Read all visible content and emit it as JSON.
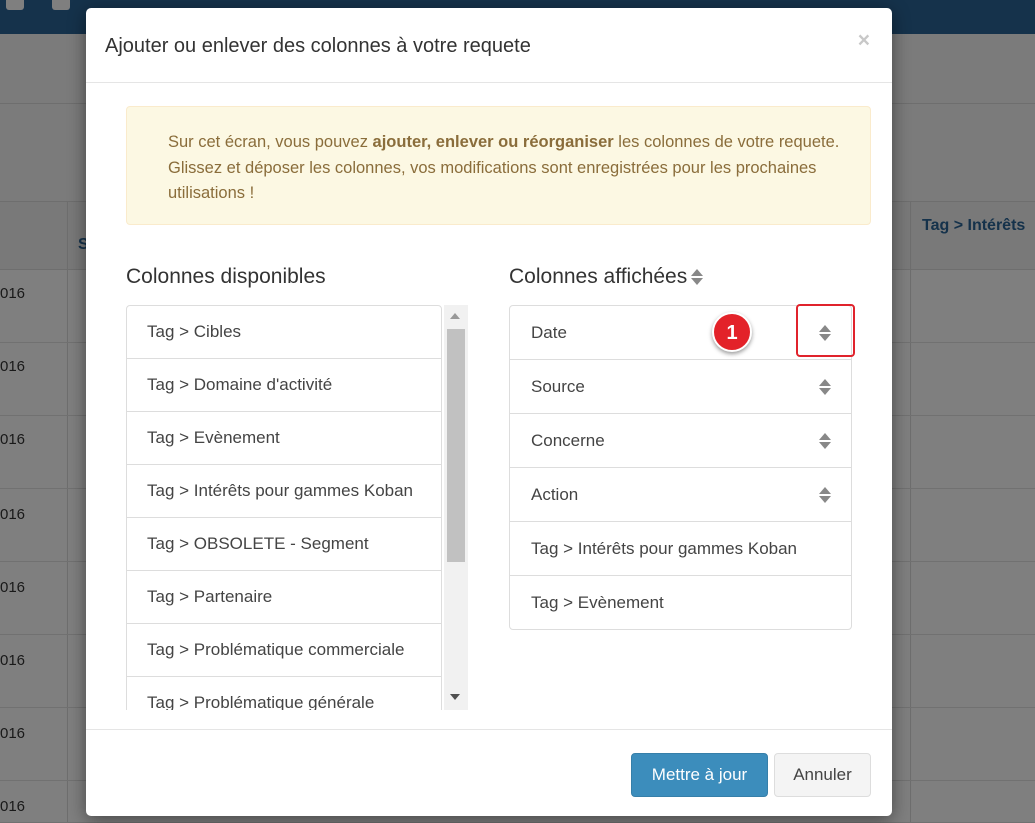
{
  "background": {
    "column_header_s": "S",
    "column_header_tag": "Tag > Intérêts",
    "row_cells": [
      "016",
      "016",
      "016",
      "016",
      "016",
      "016",
      "016",
      "016"
    ]
  },
  "modal": {
    "title": "Ajouter ou enlever des colonnes à votre requete",
    "close_label": "×",
    "alert": {
      "text_before": "Sur cet écran, vous pouvez ",
      "text_bold": "ajouter, enlever ou réorganiser",
      "text_after": " les colonnes de votre requete. Glissez et déposer les colonnes, vos modifications sont enregistrées pour les prochaines utilisations !"
    },
    "available": {
      "title": "Colonnes disponibles",
      "items": [
        "Tag > Cibles",
        "Tag > Domaine d'activité",
        "Tag > Evènement",
        "Tag > Intérêts pour gammes Koban",
        "Tag > OBSOLETE - Segment",
        "Tag > Partenaire",
        "Tag > Problématique commerciale",
        "Tag > Problématique générale"
      ]
    },
    "displayed": {
      "title": "Colonnes affichées",
      "items": [
        "Date",
        "Source",
        "Concerne",
        "Action",
        "Tag > Intérêts pour gammes Koban",
        "Tag > Evènement"
      ]
    },
    "annotation_badge": "1",
    "buttons": {
      "update": "Mettre à jour",
      "cancel": "Annuler"
    }
  }
}
